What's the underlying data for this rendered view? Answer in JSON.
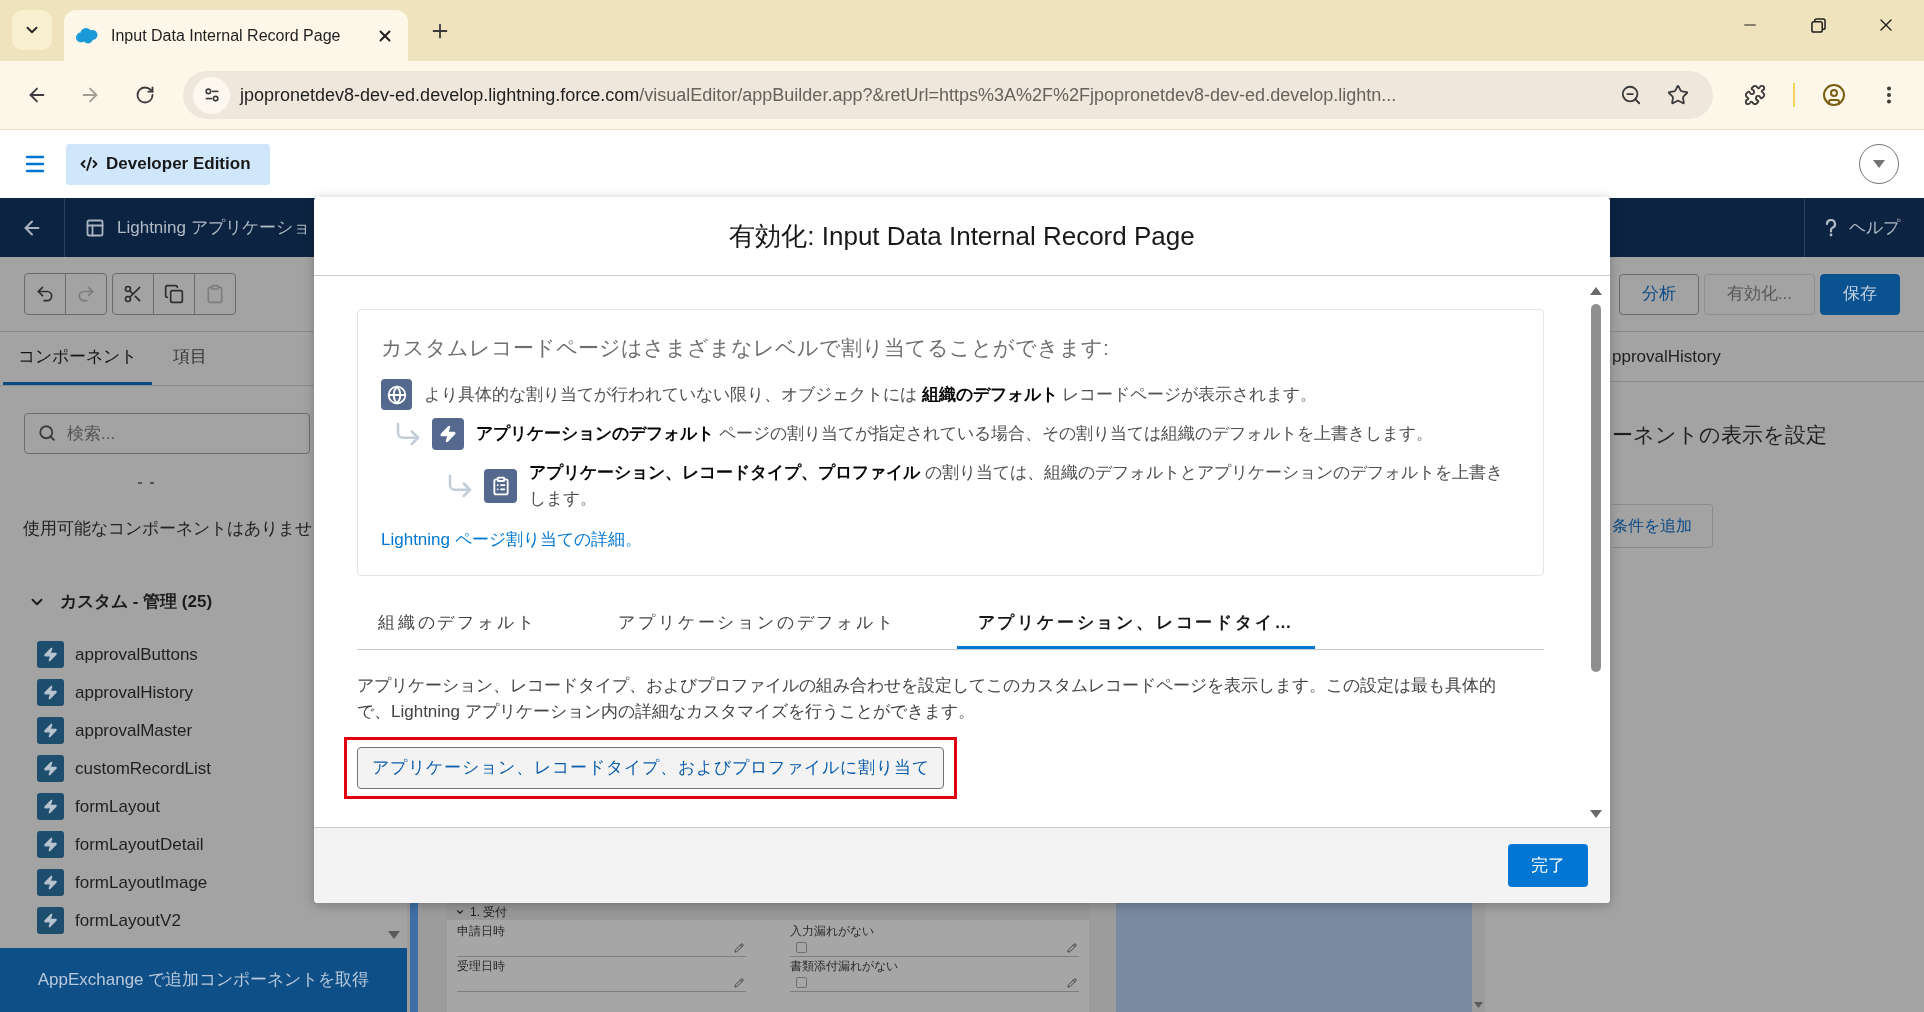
{
  "browser": {
    "tab": {
      "title": "Input Data Internal Record Page"
    },
    "url": {
      "host": "jpopronetdev8-dev-ed.develop.lightning.force.com",
      "path": "/visualEditor/appBuilder.app?&retUrl=https%3A%2F%2Fjpopronetdev8-dev-ed.develop.lightn..."
    }
  },
  "org_header": {
    "badge": "Developer Edition"
  },
  "builder_header": {
    "title": "Lightning アプリケーショ",
    "help": "ヘルプ"
  },
  "edit_tools": [
    {
      "disabled": false
    },
    {
      "disabled": true
    },
    {
      "disabled": false
    },
    {
      "disabled": false
    },
    {
      "disabled": true
    }
  ],
  "actions": [
    {
      "label": "分析",
      "kind": "neutral",
      "disabled": false
    },
    {
      "label": "有効化...",
      "kind": "neutral",
      "disabled": true
    },
    {
      "label": "保存",
      "kind": "brand",
      "disabled": false
    }
  ],
  "left_panel": {
    "tabs": [
      {
        "label": "コンポーネント",
        "selected": true
      },
      {
        "label": "項目",
        "selected": false
      }
    ],
    "search": {
      "placeholder": "検索..."
    },
    "empty_message": "使用可能なコンポーネントはありませ",
    "group": {
      "title": "カスタム - 管理 (25)",
      "expanded": true,
      "items": [
        "approvalButtons",
        "approvalHistory",
        "approvalMaster",
        "customRecordList",
        "formLayout",
        "formLayoutDetail",
        "formLayoutImage",
        "formLayoutV2"
      ]
    },
    "footer_button": "AppExchange で追加コンポーネントを取得"
  },
  "canvas": {
    "section": {
      "title": "1. 受付",
      "expanded": true,
      "fields": [
        {
          "label": "申請日時",
          "kind": "text"
        },
        {
          "label": "入力漏れがない",
          "kind": "checkbox",
          "checked": false
        },
        {
          "label": "受理日時",
          "kind": "text"
        },
        {
          "label": "書類添付漏れがない",
          "kind": "checkbox",
          "checked": false
        }
      ]
    }
  },
  "right_panel": {
    "title": "pprovalHistory",
    "heading": "ーネントの表示を設定",
    "add_button": "条件を追加"
  },
  "modal": {
    "title": "有効化: Input Data Internal Record Page",
    "intro": {
      "heading": "カスタムレコードページはさまざまなレベルで割り当てることができます:",
      "levels": [
        {
          "text": "より具体的な割り当てが行われていない限り、オブジェクトには **組織のデフォルト** レコードページが表示されます。",
          "children": [
            {
              "text": "**アプリケーションのデフォルト** ページの割り当てが指定されている場合、その割り当ては組織のデフォルトを上書きします。",
              "children": [
                {
                  "text": "**アプリケーション、レコードタイプ、プロファイル** の割り当ては、組織のデフォルトとアプリケーションのデフォルトを上書きします。"
                }
              ]
            }
          ]
        }
      ],
      "link": "Lightning ページ割り当ての詳細。"
    },
    "tabs": [
      {
        "label": "組織のデフォルト",
        "selected": false
      },
      {
        "label": "アプリケーションのデフォルト",
        "selected": false
      },
      {
        "label": "アプリケーション、レコードタイ…",
        "selected": true
      }
    ],
    "description": "アプリケーション、レコードタイプ、およびプロファイルの組み合わせを設定してこのカスタムレコードページを表示します。この設定は最も具体的で、Lightning アプリケーション内の詳細なカスタマイズを行うことができます。",
    "assign_button": {
      "label": "アプリケーション、レコードタイプ、およびプロファイルに割り当て",
      "highlighted": true
    },
    "done_button": "完了"
  }
}
